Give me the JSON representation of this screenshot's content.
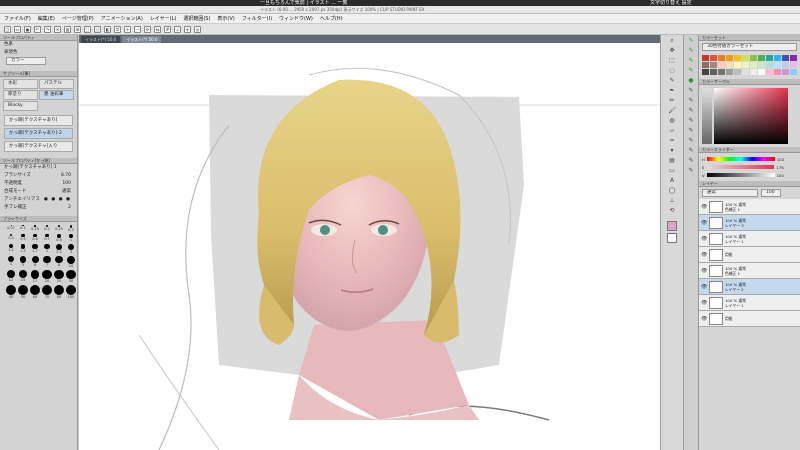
{
  "os_bar": {
    "title": "一旦もちろんで気前 | イラスト ... 一覧",
    "right_text": "文字切り替え 設定"
  },
  "window": {
    "title": "イラスト (6:00 ... 2950 x 2097 px 350dpi) 表示サイズ 100% | CLIP STUDIO PAINT EX"
  },
  "menu": {
    "items": [
      "ファイル(F)",
      "編集(E)",
      "ページ管理(P)",
      "アニメーション(A)",
      "レイヤー(L)",
      "選択範囲(S)",
      "表示(V)",
      "フィルター(I)",
      "ウィンドウ(W)",
      "ヘルプ(H)"
    ]
  },
  "tabs": [
    {
      "label": "イラスト(*) 50.0"
    },
    {
      "label": "イラスト(*) 50.0"
    }
  ],
  "left": {
    "tool_property_head": "ツールプロパティ",
    "tool_settings": [
      {
        "label": "色系"
      },
      {
        "label": "表現色"
      },
      {
        "label": "カラー"
      }
    ],
    "subtool_head": "サブツール[筆]",
    "subtool_groups": [
      "水彩",
      "パステル",
      "厚塗り",
      "墨 油彩筆",
      "Blocky"
    ],
    "subtools": [
      {
        "label": "かっ跡[テクスチャあり]"
      },
      {
        "label": "かっ跡[テクスチャあり]-2"
      },
      {
        "label": "かっ跡[テクスチャ]入り"
      }
    ],
    "property_head": "ツールプロパティ[かっ跡]",
    "property_name": "かっ跡[テクスチャあり] 1",
    "properties": [
      {
        "label": "ブラシサイズ",
        "value": "8.70"
      },
      {
        "label": "不透明度",
        "value": "100"
      },
      {
        "label": "合成モード",
        "value": "通常"
      },
      {
        "label": "アンチエイリアス",
        "value": ""
      },
      {
        "label": "手ブレ補正",
        "value": "2"
      }
    ],
    "brush_head": "ブラシサイズ",
    "brush_sizes": [
      "0.07",
      "0.1",
      "0.15",
      "0.2",
      "0.25",
      "0.3",
      "0.4",
      "0.5",
      "0.6",
      "0.7",
      "0.8",
      "1",
      "1.2",
      "1.5",
      "1.7",
      "2",
      "2.5",
      "3",
      "4",
      "5",
      "6",
      "7",
      "8",
      "10",
      "12",
      "15",
      "17",
      "20",
      "25",
      "30",
      "40",
      "50",
      "60",
      "70",
      "80",
      "100"
    ]
  },
  "right": {
    "color_set_head": "カラーセット",
    "color_set_name": "30色付随カラーセット",
    "color_wheel_head": "カラーサークル",
    "slider_head": "カラースライダー",
    "slider_values": {
      "h": "102",
      "s": "176",
      "v": "100"
    },
    "layer_head": "レイヤー",
    "blend_mode": "通常",
    "opacity": "100",
    "layers": [
      {
        "name": "100 % 通常",
        "sub": "色補正 1",
        "selected": false
      },
      {
        "name": "100 % 通常",
        "sub": "レイヤー 3",
        "selected": true
      },
      {
        "name": "100 % 通常",
        "sub": "レイヤー 1",
        "selected": false
      },
      {
        "name": "用紙",
        "sub": "",
        "selected": false
      },
      {
        "name": "100 % 通常",
        "sub": "色補正 1",
        "selected": false
      },
      {
        "name": "100 % 通常",
        "sub": "レイヤー 2",
        "selected": true
      },
      {
        "name": "100 % 通常",
        "sub": "レイヤー 1",
        "selected": false
      },
      {
        "name": "用紙",
        "sub": "",
        "selected": false
      }
    ]
  },
  "colors": {
    "selected_layer": "#c5d9ee",
    "panel": "#d3d3d3",
    "accent": "#2f9b3a"
  }
}
